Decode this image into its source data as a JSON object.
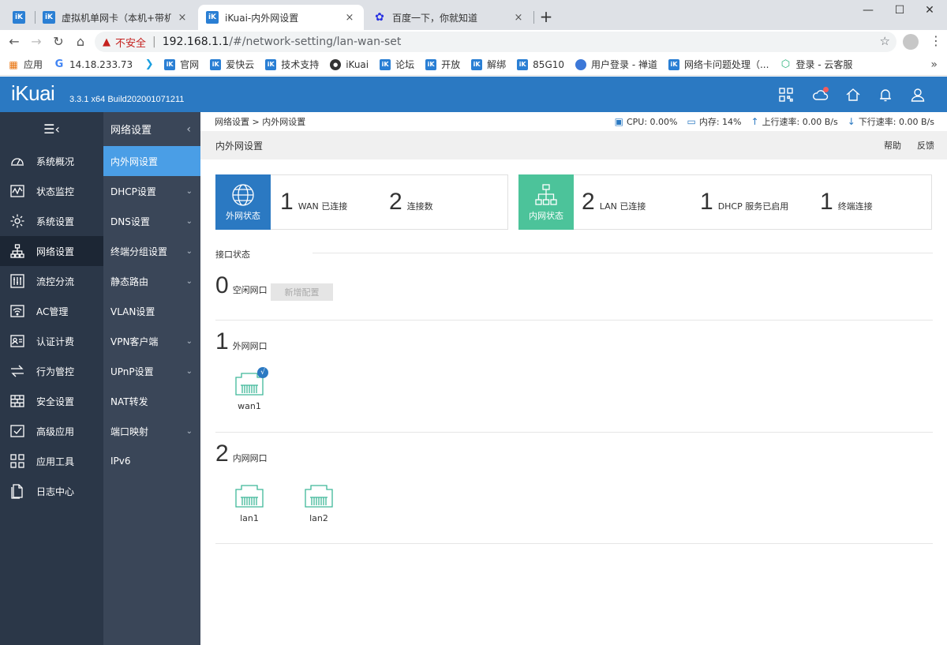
{
  "browser": {
    "tabs": [
      {
        "title": "虚拟机单网卡（本机+带机上网）",
        "close": "×"
      },
      {
        "title": "iKuai-内外网设置",
        "close": "×"
      },
      {
        "title": "百度一下，你就知道",
        "close": "×"
      }
    ],
    "new_tab": "+",
    "window_controls": {
      "minimize": "—",
      "maximize": "☐",
      "close": "✕"
    },
    "insecure_label": "不安全",
    "url_host": "192.168.1.1",
    "url_path": "/#/network-setting/lan-wan-set",
    "bookmarks": [
      {
        "label": "应用",
        "icon": "apps-icon"
      },
      {
        "label": "14.18.233.73",
        "icon": "google-icon"
      },
      {
        "label": "",
        "icon": "s-icon"
      },
      {
        "label": "官网",
        "icon": "ik-icon"
      },
      {
        "label": "爱快云",
        "icon": "ik-icon"
      },
      {
        "label": "技术支持",
        "icon": "ik-icon"
      },
      {
        "label": "iKuai",
        "icon": "github-icon"
      },
      {
        "label": "论坛",
        "icon": "ik-icon"
      },
      {
        "label": "开放",
        "icon": "ik-icon"
      },
      {
        "label": "解绑",
        "icon": "ik-icon"
      },
      {
        "label": "85G10",
        "icon": "ik-icon"
      },
      {
        "label": "用户登录 - 禅道",
        "icon": "globe-icon"
      },
      {
        "label": "网络卡问题处理（...",
        "icon": "ik-icon"
      },
      {
        "label": "登录 - 云客服",
        "icon": "cloud-icon"
      }
    ],
    "bookmarks_more": "»"
  },
  "app": {
    "logo": "iKuai",
    "version": "3.3.1 x64 Build202001071211"
  },
  "sidebar": {
    "toggle": "☰‹",
    "items": [
      {
        "label": "系统概况",
        "icon": "gauge-icon"
      },
      {
        "label": "状态监控",
        "icon": "monitor-icon"
      },
      {
        "label": "系统设置",
        "icon": "gear-icon"
      },
      {
        "label": "网络设置",
        "icon": "network-icon",
        "active": true
      },
      {
        "label": "流控分流",
        "icon": "sliders-icon"
      },
      {
        "label": "AC管理",
        "icon": "wifi-icon"
      },
      {
        "label": "认证计费",
        "icon": "id-card-icon"
      },
      {
        "label": "行为管控",
        "icon": "arrows-icon"
      },
      {
        "label": "安全设置",
        "icon": "firewall-icon"
      },
      {
        "label": "高级应用",
        "icon": "check-box-icon"
      },
      {
        "label": "应用工具",
        "icon": "apps-grid-icon"
      },
      {
        "label": "日志中心",
        "icon": "document-icon"
      }
    ]
  },
  "subside": {
    "title": "网络设置",
    "collapse": "‹",
    "items": [
      {
        "label": "内外网设置",
        "chevron": "",
        "active": true
      },
      {
        "label": "DHCP设置",
        "chevron": "⌄"
      },
      {
        "label": "DNS设置",
        "chevron": "⌄"
      },
      {
        "label": "终端分组设置",
        "chevron": "⌄"
      },
      {
        "label": "静态路由",
        "chevron": "⌄"
      },
      {
        "label": "VLAN设置",
        "chevron": ""
      },
      {
        "label": "VPN客户端",
        "chevron": "⌄"
      },
      {
        "label": "UPnP设置",
        "chevron": "⌄"
      },
      {
        "label": "NAT转发",
        "chevron": ""
      },
      {
        "label": "端口映射",
        "chevron": "⌄"
      },
      {
        "label": "IPv6",
        "chevron": ""
      }
    ]
  },
  "main": {
    "breadcrumb": "网络设置 > 内外网设置",
    "stats": {
      "cpu": "CPU: 0.00%",
      "mem": "内存: 14%",
      "up": "上行速率: 0.00 B/s",
      "down": "下行速率: 0.00 B/s"
    },
    "page_title": "内外网设置",
    "help": "帮助",
    "feedback": "反馈",
    "wan_card": {
      "badge": "外网状态",
      "items": [
        {
          "num": "1",
          "label": "WAN 已连接"
        },
        {
          "num": "2",
          "label": "连接数"
        }
      ]
    },
    "lan_card": {
      "badge": "内网状态",
      "items": [
        {
          "num": "2",
          "label": "LAN 已连接"
        },
        {
          "num": "1",
          "label": "DHCP 服务已启用"
        },
        {
          "num": "1",
          "label": "终端连接"
        }
      ]
    },
    "section_label": "接口状态",
    "idle": {
      "num": "0",
      "label": "空闲网口",
      "button": "新增配置"
    },
    "wan": {
      "num": "1",
      "label": "外网网口",
      "ports": [
        {
          "name": "wan1",
          "check": "√"
        }
      ]
    },
    "lan": {
      "num": "2",
      "label": "内网网口",
      "ports": [
        {
          "name": "lan1"
        },
        {
          "name": "lan2"
        }
      ]
    }
  },
  "colors": {
    "brand_blue": "#2b79c2",
    "sidebar_dark": "#2b3748",
    "subside": "#3a4658",
    "active_sub": "#4a9ee6",
    "lan_green": "#4cc39a",
    "port_green": "#3fb899",
    "insecure_red": "#c5221f"
  }
}
